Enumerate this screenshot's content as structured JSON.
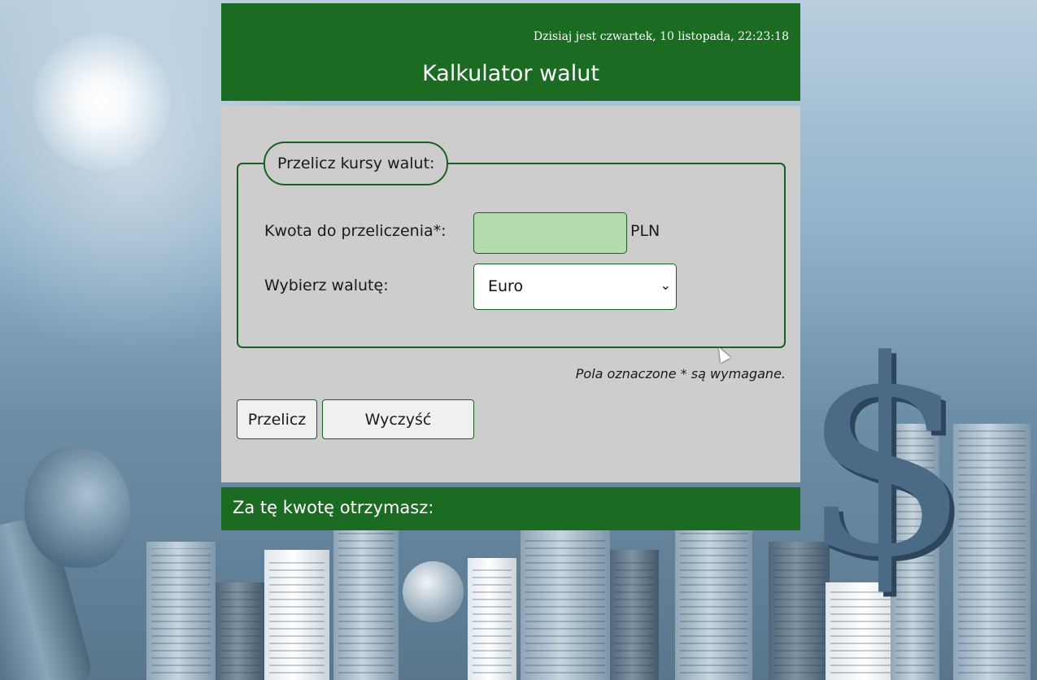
{
  "header": {
    "date_text": "Dzisiaj jest czwartek, 10 listopada, 22:23:18",
    "title": "Kalkulator walut"
  },
  "form": {
    "legend": "Przelicz kursy walut:",
    "amount_label": "Kwotа do przeliczenia*:",
    "amount_value": "",
    "amount_unit": "PLN",
    "currency_label": "Wybierz walutę:",
    "currency_selected": "Euro",
    "required_note": "Pola oznaczone * są wymagane."
  },
  "buttons": {
    "convert": "Przelicz",
    "clear": "Wyczyść"
  },
  "result": {
    "label": "Za tę kwotę otrzymasz:"
  },
  "colors": {
    "accent": "#1b6b23",
    "panel": "#cccdcc",
    "input_fill": "#b7dbb0"
  }
}
